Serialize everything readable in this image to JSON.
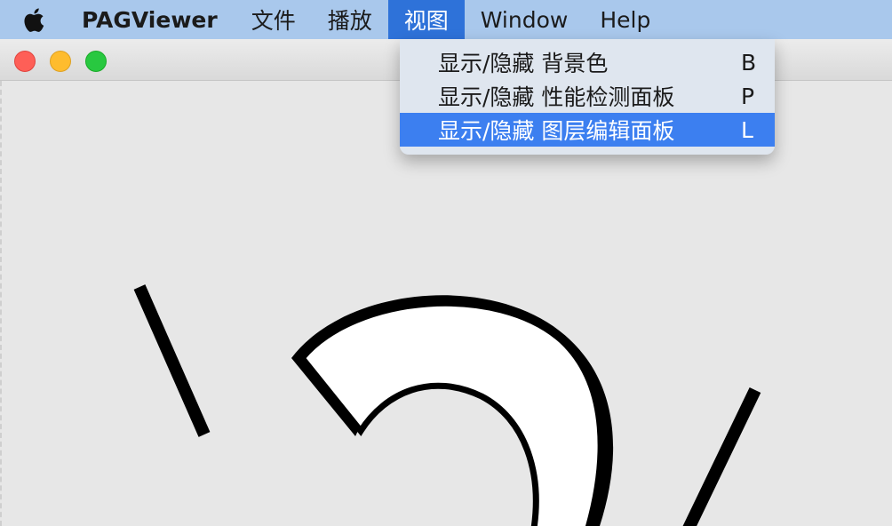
{
  "menubar": {
    "apple_icon": "apple-logo-icon",
    "app_name": "PAGViewer",
    "items": [
      "文件",
      "播放",
      "视图",
      "Window",
      "Help"
    ],
    "open_menu": "视图"
  },
  "view_menu": {
    "items": [
      {
        "label": "显示/隐藏 背景色",
        "shortcut": "B"
      },
      {
        "label": "显示/隐藏 性能检测面板",
        "shortcut": "P"
      },
      {
        "label": "显示/隐藏 图层编辑面板",
        "shortcut": "L"
      }
    ],
    "highlighted_index": 2
  },
  "window": {
    "traffic_lights": [
      "close",
      "minimize",
      "zoom"
    ]
  },
  "colors": {
    "menubar_bg": "#a9c8ec",
    "menu_highlight": "#3c7ff0",
    "close": "#fe5f57",
    "minimize": "#febc2e",
    "zoom": "#28c840"
  }
}
